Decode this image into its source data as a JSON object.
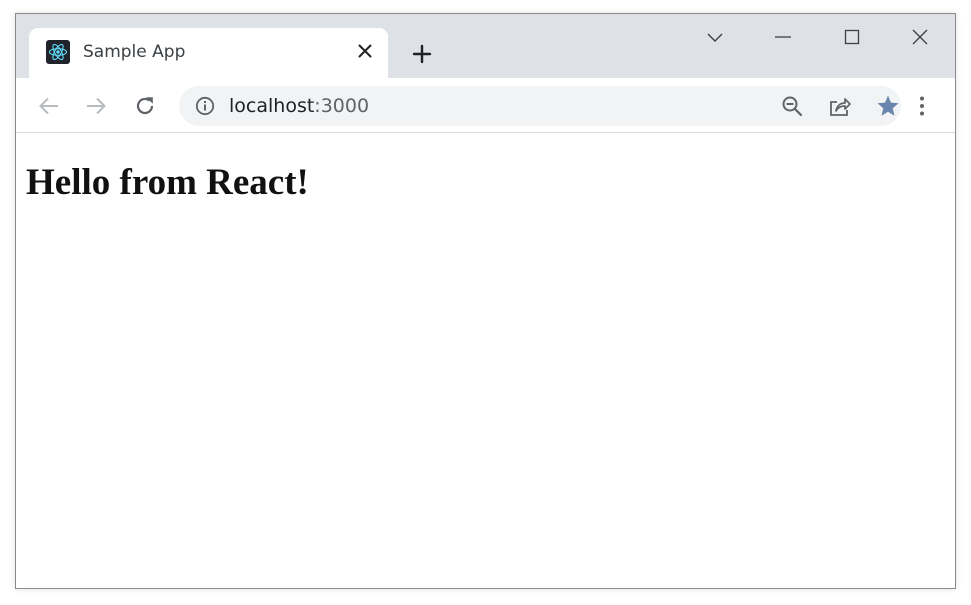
{
  "browser": {
    "tab": {
      "title": "Sample App",
      "favicon": "react-logo-icon"
    },
    "new_tab_icon": "plus-icon",
    "window_controls": [
      "tab-search-chevron-icon",
      "minimize-icon",
      "maximize-icon",
      "close-window-icon"
    ],
    "toolbar": {
      "back_icon": "back-arrow-icon",
      "forward_icon": "forward-arrow-icon",
      "reload_icon": "reload-icon",
      "url_host": "localhost",
      "url_port": ":3000",
      "omnibox_icons": [
        "site-info-icon",
        "zoom-out-icon",
        "share-icon",
        "bookmark-star-icon"
      ],
      "menu_icon": "kebab-menu-icon"
    },
    "colors": {
      "tabstrip": "#dee1e6",
      "omnibox": "#f1f3f4",
      "star_active": "#6a85ad",
      "react_logo": "#61dafb"
    }
  },
  "page": {
    "heading": "Hello from React!"
  }
}
